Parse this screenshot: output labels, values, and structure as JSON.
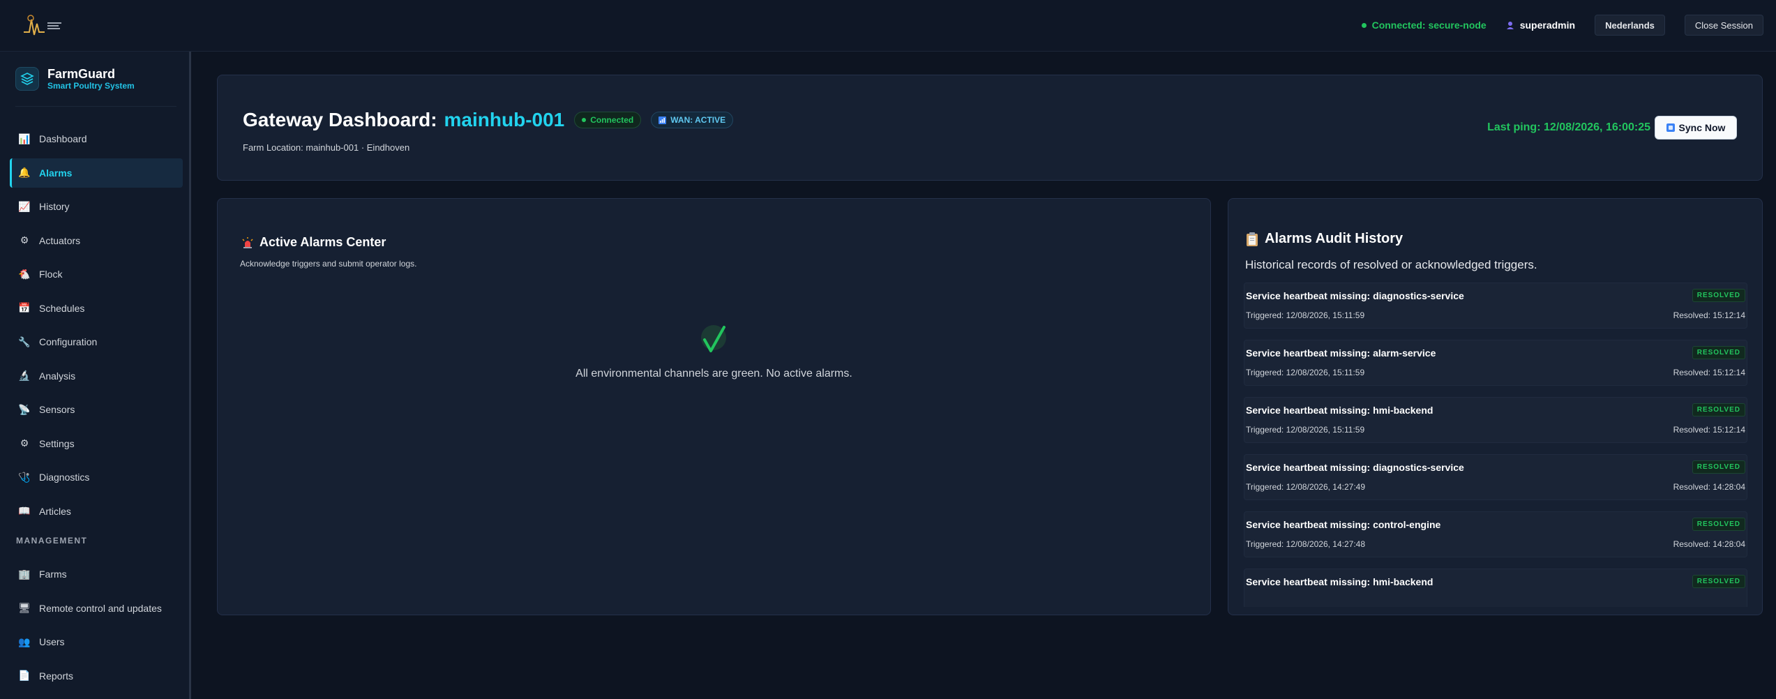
{
  "topbar": {
    "connection_status": "Connected: secure-node",
    "username": "superadmin",
    "language_label": "Nederlands",
    "close_session_label": "Close Session"
  },
  "sidebar": {
    "brand_name": "FarmGuard",
    "brand_sub": "Smart Poultry System",
    "items": [
      {
        "label": "Dashboard",
        "icon": "bar-chart-icon",
        "glyph": "📊"
      },
      {
        "label": "Alarms",
        "icon": "bell-icon",
        "glyph": "🔔",
        "active": true
      },
      {
        "label": "History",
        "icon": "line-chart-icon",
        "glyph": "📈"
      },
      {
        "label": "Actuators",
        "icon": "gear-icon",
        "glyph": "⚙"
      },
      {
        "label": "Flock",
        "icon": "chicken-icon",
        "glyph": "🐔"
      },
      {
        "label": "Schedules",
        "icon": "calendar-icon",
        "glyph": "📅"
      },
      {
        "label": "Configuration",
        "icon": "wrench-icon",
        "glyph": "🔧"
      },
      {
        "label": "Analysis",
        "icon": "microscope-icon",
        "glyph": "🔬"
      },
      {
        "label": "Sensors",
        "icon": "antenna-icon",
        "glyph": "📡"
      },
      {
        "label": "Settings",
        "icon": "gear-icon",
        "glyph": "⚙"
      },
      {
        "label": "Diagnostics",
        "icon": "stethoscope-icon",
        "glyph": "🩺"
      },
      {
        "label": "Articles",
        "icon": "book-icon",
        "glyph": "📖"
      }
    ],
    "management_title": "MANAGEMENT",
    "management_items": [
      {
        "label": "Farms",
        "icon": "building-icon",
        "glyph": "🏢"
      },
      {
        "label": "Remote control and updates",
        "icon": "monitor-icon",
        "glyph": "🖥"
      },
      {
        "label": "Users",
        "icon": "users-icon",
        "glyph": "👥"
      },
      {
        "label": "Reports",
        "icon": "document-icon",
        "glyph": "📄"
      }
    ]
  },
  "header": {
    "title_label": "Gateway Dashboard:",
    "gateway_name": "mainhub-001",
    "connected_pill": "Connected",
    "wan_pill": "WAN: ACTIVE",
    "farm_location": "Farm Location: mainhub-001 · Eindhoven",
    "last_ping": "Last ping: 12/08/2026, 16:00:25",
    "sync_label": "Sync Now"
  },
  "active_alarms": {
    "title": "Active Alarms Center",
    "subtitle": "Acknowledge triggers and submit operator logs.",
    "empty_message": "All environmental channels are green. No active alarms."
  },
  "audit": {
    "title": "Alarms Audit History",
    "subtitle": "Historical records of resolved or acknowledged triggers.",
    "items": [
      {
        "message": "Service heartbeat missing: diagnostics-service",
        "status": "RESOLVED",
        "triggered": "Triggered: 12/08/2026, 15:11:59",
        "resolved": "Resolved: 15:12:14"
      },
      {
        "message": "Service heartbeat missing: alarm-service",
        "status": "RESOLVED",
        "triggered": "Triggered: 12/08/2026, 15:11:59",
        "resolved": "Resolved: 15:12:14"
      },
      {
        "message": "Service heartbeat missing: hmi-backend",
        "status": "RESOLVED",
        "triggered": "Triggered: 12/08/2026, 15:11:59",
        "resolved": "Resolved: 15:12:14"
      },
      {
        "message": "Service heartbeat missing: diagnostics-service",
        "status": "RESOLVED",
        "triggered": "Triggered: 12/08/2026, 14:27:49",
        "resolved": "Resolved: 14:28:04"
      },
      {
        "message": "Service heartbeat missing: control-engine",
        "status": "RESOLVED",
        "triggered": "Triggered: 12/08/2026, 14:27:48",
        "resolved": "Resolved: 14:28:04"
      },
      {
        "message": "Service heartbeat missing: hmi-backend",
        "status": "RESOLVED",
        "triggered": "",
        "resolved": ""
      }
    ]
  },
  "colors": {
    "accent": "#22d3ee",
    "success": "#22c55e",
    "background": "#0d1421",
    "card": "#162032"
  }
}
